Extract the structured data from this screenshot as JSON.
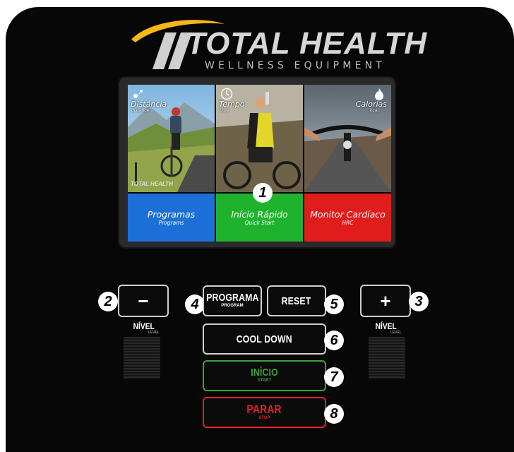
{
  "brand": {
    "name": "TOTAL HEALTH",
    "tagline": "WELLNESS EQUIPMENT",
    "mini_logo": "TOTAL HEALTH"
  },
  "screen": {
    "tiles": [
      {
        "label": "Distância",
        "sub": "distance",
        "icon": "route-pin-icon"
      },
      {
        "label": "Tempo",
        "sub": "time",
        "icon": "clock-icon"
      },
      {
        "label": "Calorias",
        "sub": "kcal",
        "icon": "flame-icon"
      }
    ],
    "buttons": [
      {
        "label": "Programas",
        "sub": "Programs",
        "color": "#1d6fd8"
      },
      {
        "label": "Início Rápido",
        "sub": "Quick Start",
        "color": "#1fb32d"
      },
      {
        "label": "Monitor Cardíaco",
        "sub": "HRC",
        "color": "#e01c1c"
      }
    ]
  },
  "keys": {
    "minus": {
      "symbol": "−"
    },
    "plus": {
      "symbol": "+"
    },
    "programa": {
      "label": "PROGRAMA",
      "sub": "PROGRAM"
    },
    "reset": {
      "label": "RESET"
    },
    "cool_down": {
      "label": "COOL DOWN"
    },
    "inicio": {
      "label": "INÍCIO",
      "sub": "START",
      "color": "#3aa43a"
    },
    "parar": {
      "label": "PARAR",
      "sub": "STOP",
      "color": "#e02424"
    }
  },
  "level": {
    "label": "NÍVEL",
    "sub": "LEVEL"
  },
  "callouts": [
    "1",
    "2",
    "3",
    "4",
    "5",
    "6",
    "7",
    "8"
  ]
}
